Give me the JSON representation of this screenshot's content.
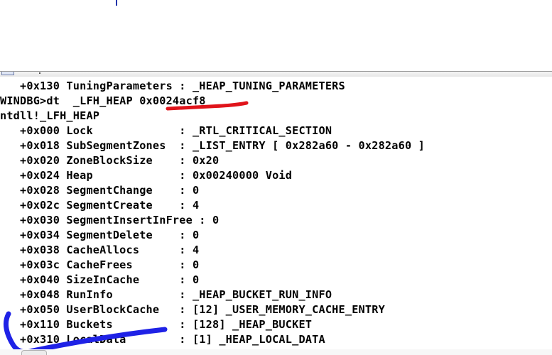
{
  "debugger": {
    "lines": [
      "   +0x130 TuningParameters : _HEAP_TUNING_PARAMETERS",
      "WINDBG>dt  _LFH_HEAP 0x0024acf8",
      "ntdll!_LFH_HEAP",
      "   +0x000 Lock             : _RTL_CRITICAL_SECTION",
      "   +0x018 SubSegmentZones  : _LIST_ENTRY [ 0x282a60 - 0x282a60 ]",
      "   +0x020 ZoneBlockSize    : 0x20",
      "   +0x024 Heap             : 0x00240000 Void",
      "   +0x028 SegmentChange    : 0",
      "   +0x02c SegmentCreate    : 4",
      "   +0x030 SegmentInsertInFree : 0",
      "   +0x034 SegmentDelete    : 0",
      "   +0x038 CacheAllocs      : 4",
      "   +0x03c CacheFrees       : 0",
      "   +0x040 SizeInCache      : 0",
      "   +0x048 RunInfo          : _HEAP_BUCKET_RUN_INFO",
      "   +0x050 UserBlockCache   : [12] _USER_MEMORY_CACHE_ENTRY",
      "   +0x110 Buckets          : [128] _HEAP_BUCKET",
      "   +0x310 LocalData        : [1] _HEAP_LOCAL_DATA"
    ]
  },
  "annotations": {
    "underline_color": "#e0141b",
    "scribble_color": "#1f22e6"
  }
}
